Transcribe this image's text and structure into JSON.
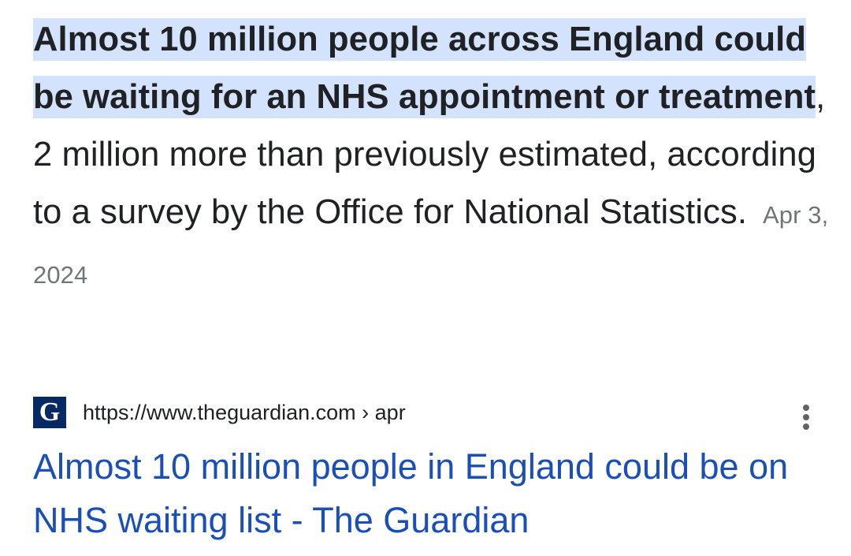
{
  "snippet": {
    "highlight": "Almost 10 million people across England could be waiting for an NHS appointment or treatment",
    "rest": ", 2 million more than previously estimated, according to a survey by the Office for National Statistics.",
    "date": "Apr 3, 2024"
  },
  "source": {
    "favicon_letter": "G",
    "url": "https://www.theguardian.com › apr",
    "favicon_color": "#052962"
  },
  "result": {
    "title": "Almost 10 million people in England could be on NHS waiting list - The Guardian",
    "link_color": "#1a4fb8"
  },
  "icons": {
    "menu": "more-vert-icon"
  }
}
